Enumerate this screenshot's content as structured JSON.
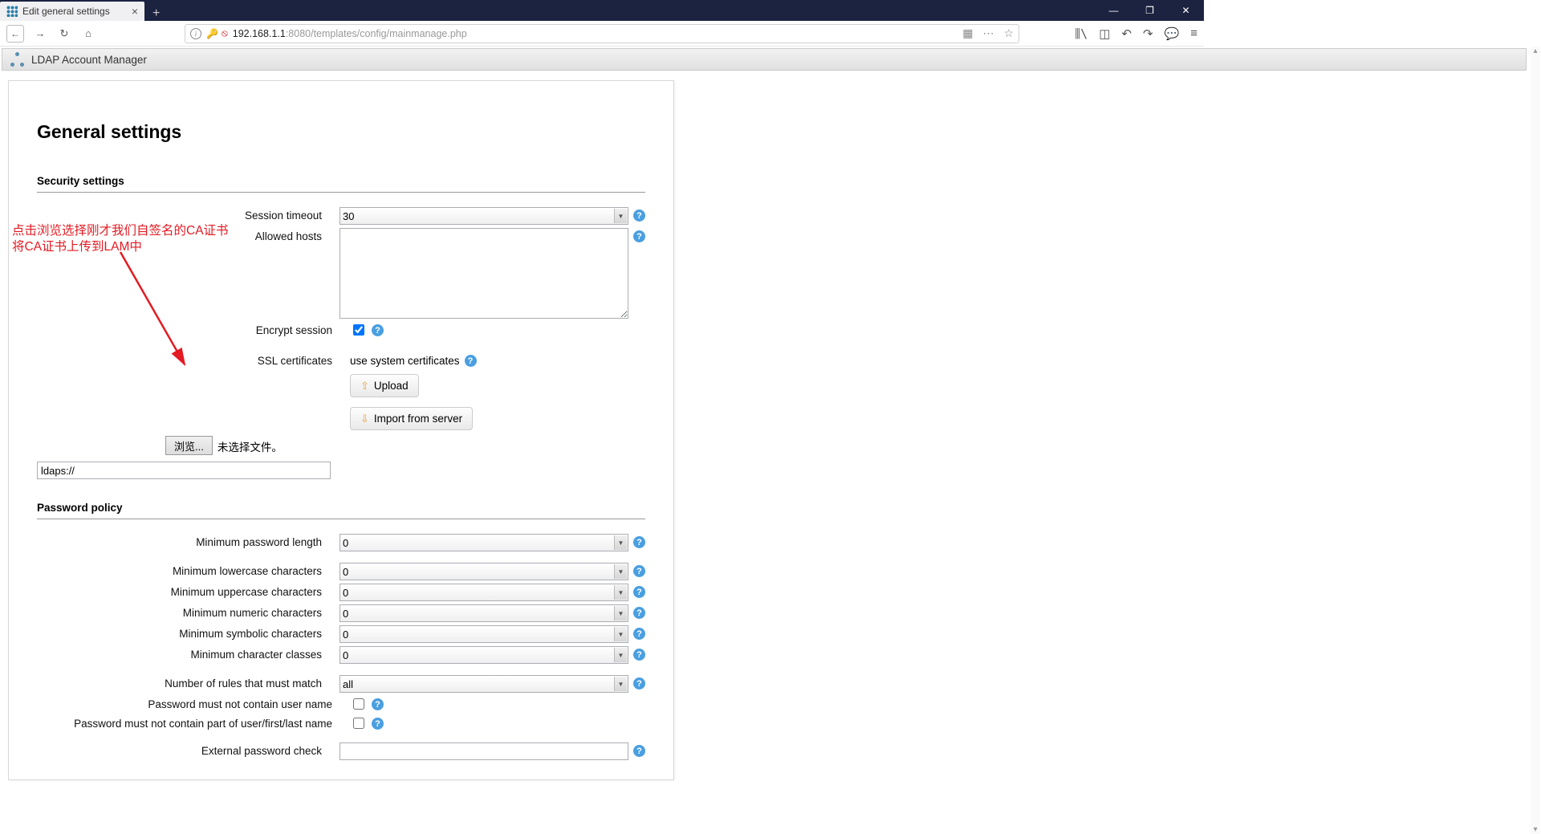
{
  "browser": {
    "tab_title": "Edit general settings",
    "url_host": "192.168.1.1",
    "url_port": ":8080",
    "url_path": "/templates/config/mainmanage.php"
  },
  "app": {
    "title": "LDAP Account Manager"
  },
  "page_title": "General settings",
  "annotation": {
    "line1": "点击浏览选择刚才我们自签名的CA证书",
    "line2": "将CA证书上传到LAM中"
  },
  "sections": {
    "security": {
      "title": "Security settings",
      "session_timeout_label": "Session timeout",
      "session_timeout_value": "30",
      "allowed_hosts_label": "Allowed hosts",
      "allowed_hosts_value": "",
      "encrypt_session_label": "Encrypt session",
      "encrypt_session_checked": true,
      "ssl_label": "SSL certificates",
      "ssl_status": "use system certificates",
      "upload_btn": "Upload",
      "import_btn": "Import from server",
      "browse_btn": "浏览...",
      "browse_status": "未选择文件。",
      "ldaps_value": "ldaps://"
    },
    "password": {
      "title": "Password policy",
      "min_length_label": "Minimum password length",
      "min_length_value": "0",
      "min_lower_label": "Minimum lowercase characters",
      "min_lower_value": "0",
      "min_upper_label": "Minimum uppercase characters",
      "min_upper_value": "0",
      "min_numeric_label": "Minimum numeric characters",
      "min_numeric_value": "0",
      "min_symbol_label": "Minimum symbolic characters",
      "min_symbol_value": "0",
      "min_classes_label": "Minimum character classes",
      "min_classes_value": "0",
      "rules_match_label": "Number of rules that must match",
      "rules_match_value": "all",
      "no_username_label": "Password must not contain user name",
      "no_username_checked": false,
      "no_name_parts_label": "Password must not contain part of user/first/last name",
      "no_name_parts_checked": false,
      "ext_check_label": "External password check",
      "ext_check_value": ""
    }
  }
}
